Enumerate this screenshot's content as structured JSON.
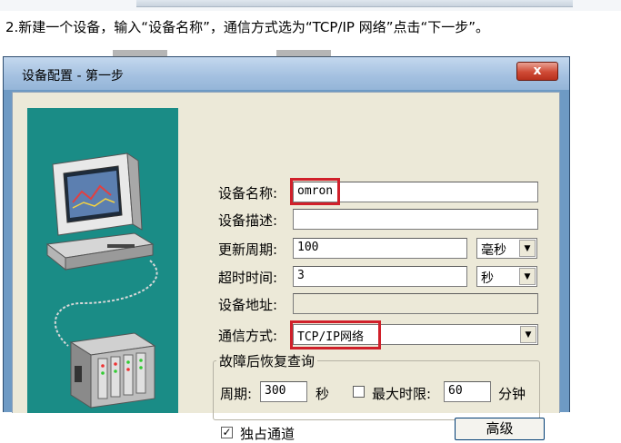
{
  "instruction": "2.新建一个设备，输入“设备名称”，通信方式选为“TCP/IP 网络”点击“下一步”。",
  "dialog": {
    "title": "设备配置 - 第一步",
    "close_label": "x"
  },
  "form": {
    "device_name_label": "设备名称:",
    "device_name_value": "omron",
    "device_desc_label": "设备描述:",
    "device_desc_value": "",
    "update_period_label": "更新周期:",
    "update_period_value": "100",
    "update_period_unit": "毫秒",
    "timeout_label": "超时时间:",
    "timeout_value": "3",
    "timeout_unit": "秒",
    "device_address_label": "设备地址:",
    "device_address_value": "",
    "comm_mode_label": "通信方式:",
    "comm_mode_value": "TCP/IP网络"
  },
  "recovery": {
    "legend": "故障后恢复查询",
    "period_label": "周期:",
    "period_value": "300",
    "period_unit": "秒",
    "max_time_label": "最大时限:",
    "max_time_checked": false,
    "max_time_value": "60",
    "max_time_unit": "分钟"
  },
  "exclusive_label": "独占通道",
  "exclusive_checked": true,
  "advanced_button": "高级",
  "icons": {
    "illustration": "computer-and-plc-illustration",
    "dropdown": "chevron-down-icon",
    "close": "close-icon",
    "check": "check-icon"
  },
  "colors": {
    "highlight": "#d0202a",
    "illustration_bg": "#1a8c86",
    "dialog_bg": "#ece9d8",
    "titlebar": "#a3c0e0"
  }
}
